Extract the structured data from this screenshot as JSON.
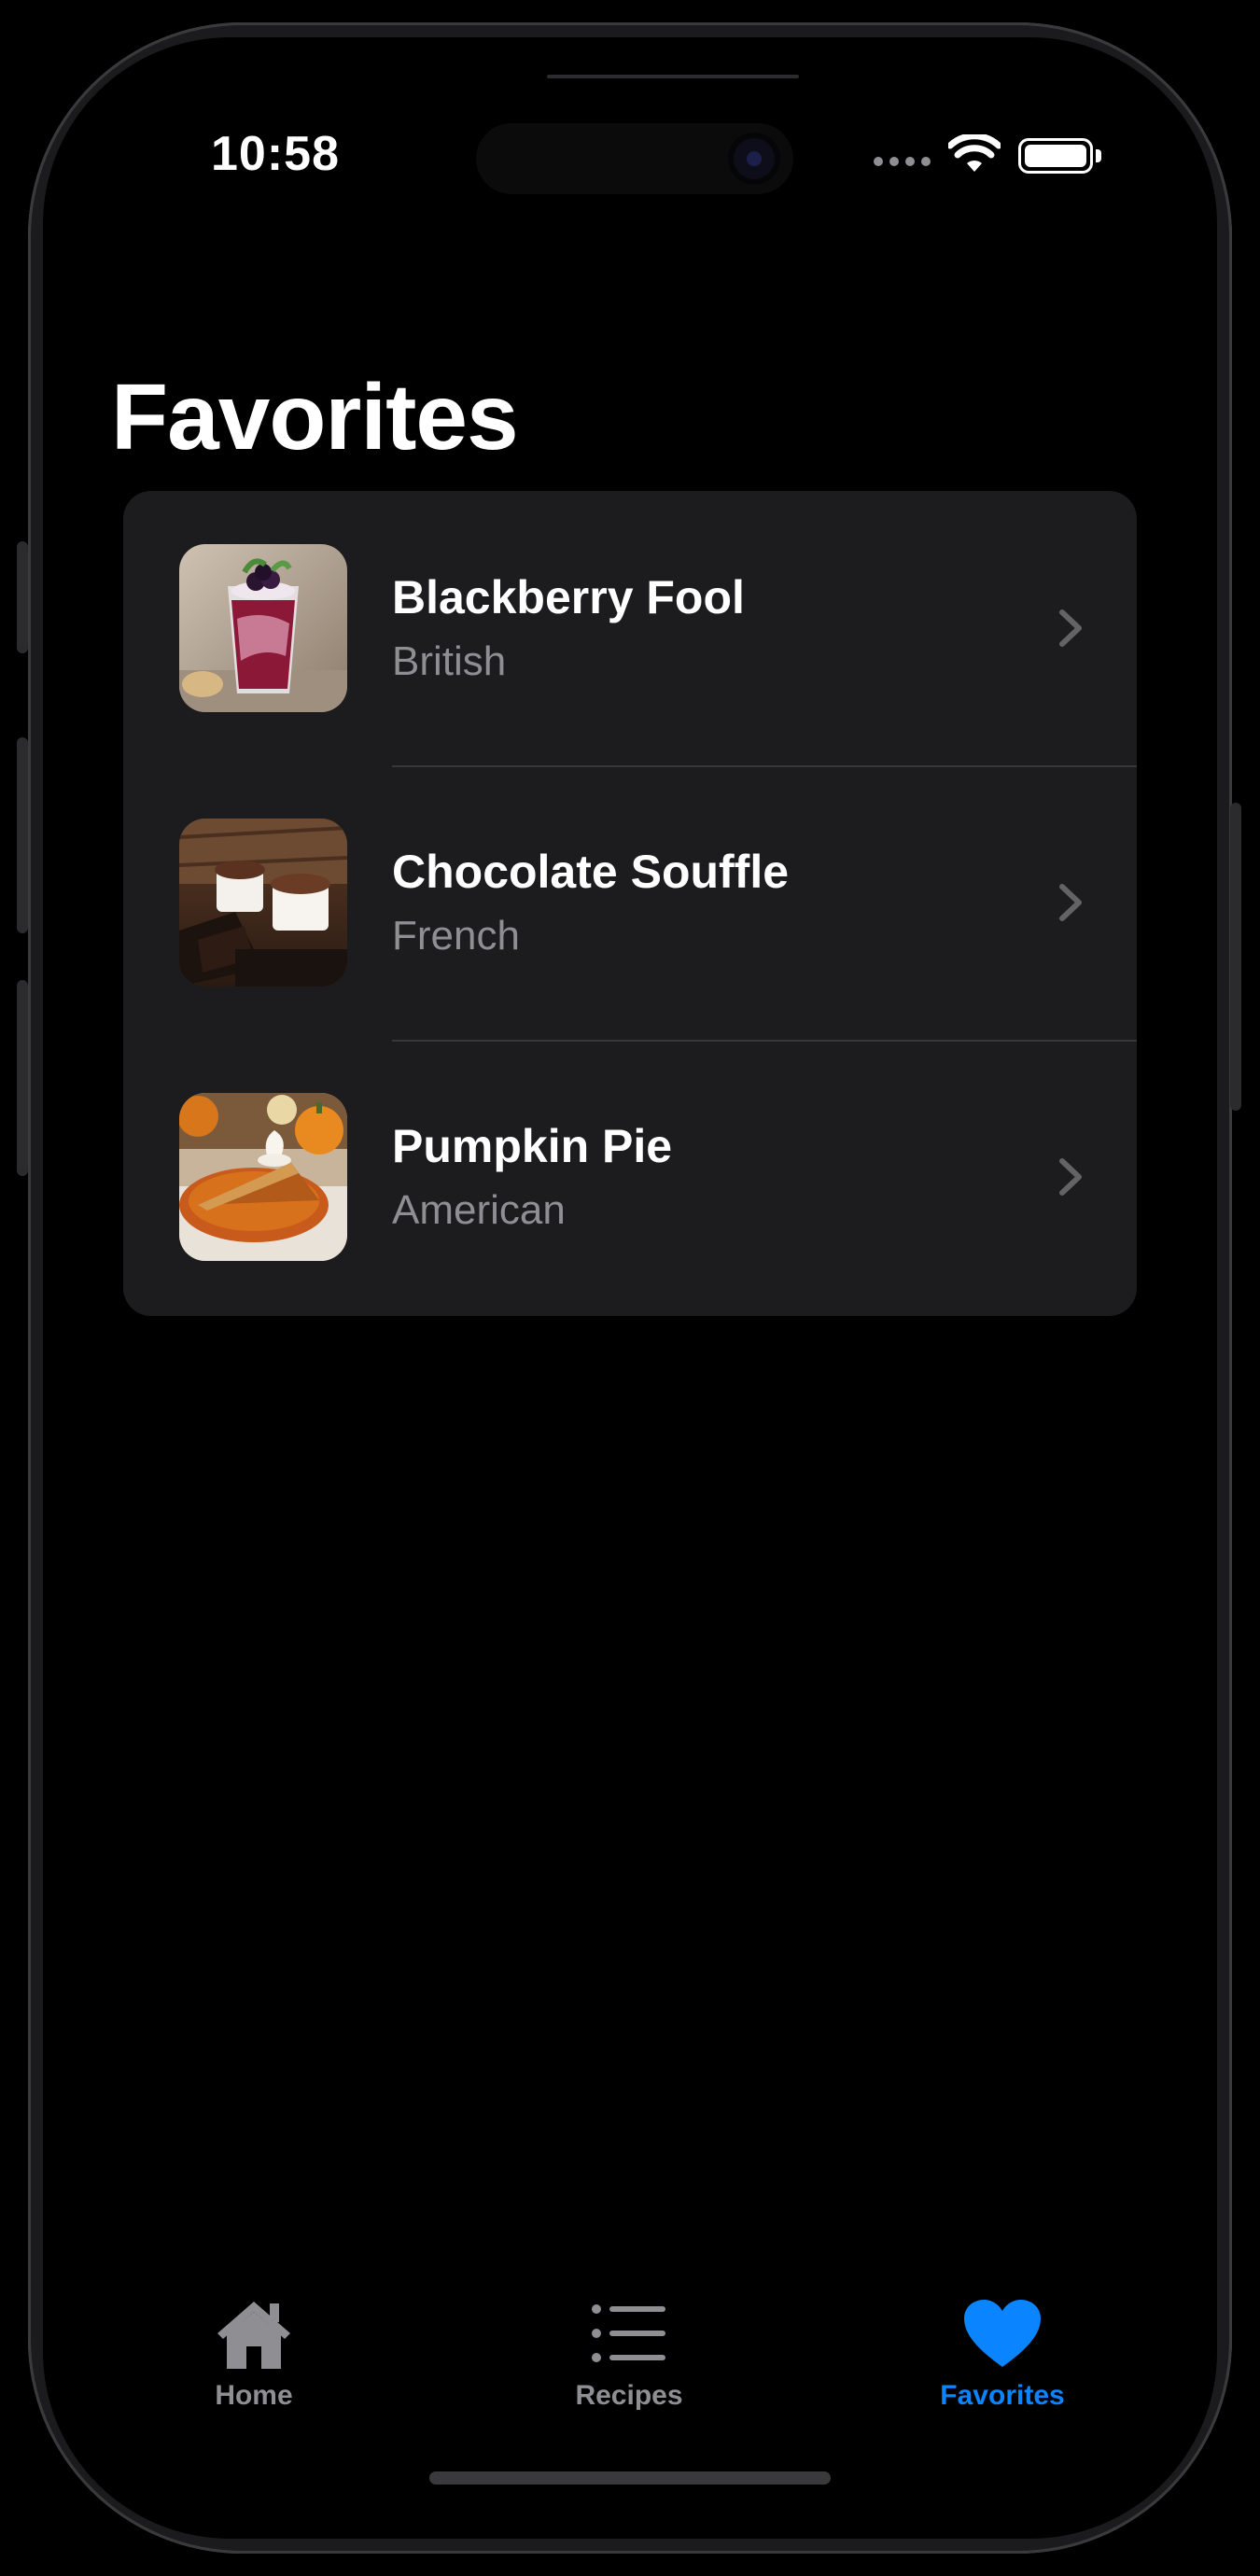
{
  "status_bar": {
    "time": "10:58"
  },
  "page": {
    "title": "Favorites"
  },
  "favorites": [
    {
      "name": "Blackberry Fool",
      "cuisine": "British",
      "image": "blackberry-fool-photo"
    },
    {
      "name": "Chocolate Souffle",
      "cuisine": "French",
      "image": "chocolate-souffle-photo"
    },
    {
      "name": "Pumpkin Pie",
      "cuisine": "American",
      "image": "pumpkin-pie-photo"
    }
  ],
  "tab_bar": {
    "items": [
      {
        "label": "Home",
        "icon": "house-icon",
        "selected": false
      },
      {
        "label": "Recipes",
        "icon": "list-icon",
        "selected": false
      },
      {
        "label": "Favorites",
        "icon": "heart-icon",
        "selected": true
      }
    ]
  },
  "colors": {
    "background": "#000000",
    "card": "#1c1c1e",
    "accent": "#0a84ff",
    "secondary_text": "#8e8e93",
    "separator": "#38383a"
  }
}
